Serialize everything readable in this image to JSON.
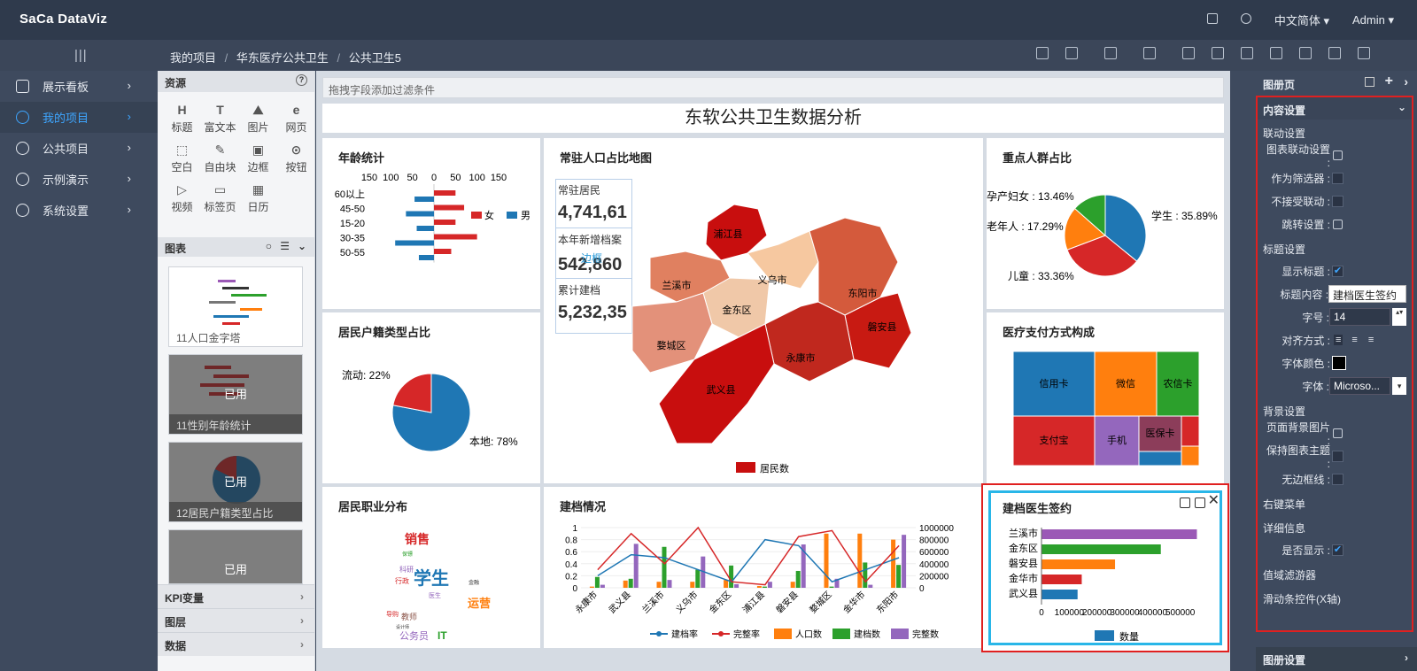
{
  "app": {
    "brand": "SaCa DataViz",
    "language": "中文简体",
    "user": "Admin"
  },
  "breadcrumb": [
    "我的项目",
    "华东医疗公共卫生",
    "公共卫生5"
  ],
  "sidebar": [
    {
      "label": "展示看板",
      "icon": "monitor-icon"
    },
    {
      "label": "我的项目",
      "icon": "user-icon",
      "active": true
    },
    {
      "label": "公共项目",
      "icon": "refresh-icon"
    },
    {
      "label": "示例演示",
      "icon": "play-icon"
    },
    {
      "label": "系统设置",
      "icon": "gear-icon"
    }
  ],
  "resources": {
    "title": "资源",
    "items": [
      "标题",
      "富文本",
      "图片",
      "网页",
      "空白",
      "自由块",
      "边框",
      "按钮",
      "视频",
      "标签页",
      "日历"
    ],
    "charts_title": "图表",
    "thumbs": [
      {
        "caption": "11人口金字塔",
        "used": false
      },
      {
        "caption": "11性别年龄统计",
        "used": true
      },
      {
        "caption": "12居民户籍类型占比",
        "used": true
      },
      {
        "caption": "",
        "used": true
      }
    ],
    "used_label": "已用",
    "sections": [
      "KPI变量",
      "图层",
      "数据"
    ]
  },
  "canvas": {
    "filter_hint": "拖拽字段添加过滤条件",
    "dashboard_title": "东软公共卫生数据分析"
  },
  "panels": {
    "age": {
      "title": "年龄统计",
      "categories": [
        "60以上",
        "45-50",
        "15-20",
        "30-35",
        "50-55"
      ],
      "legend_female": "女",
      "legend_male": "男",
      "ticks": [
        "150",
        "100",
        "50",
        "0",
        "50",
        "100",
        "150"
      ]
    },
    "map": {
      "title": "常驻人口占比地图",
      "kpis": [
        {
          "label": "常驻居民",
          "value": "4,741,61"
        },
        {
          "label": "本年新增档案",
          "value": "542,860"
        },
        {
          "label": "累计建档",
          "value": "5,232,35"
        }
      ],
      "border_label": "边框",
      "regions": [
        "浦江县",
        "兰溪市",
        "义乌市",
        "东阳市",
        "金东区",
        "婺城区",
        "磐安县",
        "永康市",
        "武义县"
      ],
      "legend": "居民数"
    },
    "key_pop": {
      "title": "重点人群占比",
      "slices": [
        {
          "label": "学生 : 35.89%",
          "value": 35.89,
          "color": "#1f77b4"
        },
        {
          "label": "儿童 : 33.36%",
          "value": 33.36,
          "color": "#d62728"
        },
        {
          "label": "老年人 : 17.29%",
          "value": 17.29,
          "color": "#ff7f0e"
        },
        {
          "label": "孕产妇女 : 13.46%",
          "value": 13.46,
          "color": "#2ca02c"
        }
      ]
    },
    "household": {
      "title": "居民户籍类型占比",
      "slices": [
        {
          "label": "本地: 78%",
          "value": 78,
          "color": "#1f77b4"
        },
        {
          "label": "流动: 22%",
          "value": 22,
          "color": "#d62728"
        }
      ]
    },
    "payment": {
      "title": "医疗支付方式构成",
      "tiles": [
        "信用卡",
        "微信",
        "农信卡",
        "支付宝",
        "手机",
        "医保卡"
      ]
    },
    "occupation": {
      "title": "居民职业分布",
      "words": [
        "销售",
        "保镖",
        "科研",
        "学生",
        "行政",
        "金融",
        "医生",
        "运营",
        "导购",
        "教师",
        "设计师",
        "公务员",
        "IT"
      ]
    },
    "archive": {
      "title": "建档情况",
      "categories": [
        "永康市",
        "武义县",
        "兰溪市",
        "义乌市",
        "金东区",
        "浦江县",
        "磐安县",
        "婺城区",
        "金华市",
        "东阳市"
      ],
      "yleft": [
        "1",
        "0.8",
        "0.6",
        "0.4",
        "0.2",
        "0"
      ],
      "yright": [
        "1000000",
        "800000",
        "600000",
        "400000",
        "200000",
        "0"
      ],
      "legend": [
        "建档率",
        "完整率",
        "人口数",
        "建档数",
        "完整数"
      ]
    },
    "signing": {
      "title": "建档医生签约",
      "legend": "数量",
      "xticks": [
        "0",
        "100000",
        "200000",
        "300000",
        "400000",
        "500000"
      ]
    }
  },
  "chart_data": [
    {
      "type": "bar",
      "title": "年龄统计",
      "categories": [
        "60以上",
        "45-50",
        "15-20",
        "30-35",
        "50-55"
      ],
      "series": [
        {
          "name": "女",
          "values": [
            50,
            70,
            50,
            100,
            40
          ]
        },
        {
          "name": "男",
          "values": [
            45,
            65,
            40,
            90,
            35
          ]
        }
      ],
      "xlim": [
        -150,
        150
      ]
    },
    {
      "type": "pie",
      "title": "重点人群占比",
      "categories": [
        "学生",
        "儿童",
        "老年人",
        "孕产妇女"
      ],
      "values": [
        35.89,
        33.36,
        17.29,
        13.46
      ]
    },
    {
      "type": "pie",
      "title": "居民户籍类型占比",
      "categories": [
        "本地",
        "流动"
      ],
      "values": [
        78,
        22
      ]
    },
    {
      "type": "bar",
      "title": "建档医生签约",
      "categories": [
        "兰溪市",
        "金东区",
        "磐安县",
        "金华市",
        "武义县"
      ],
      "values": [
        560000,
        430000,
        265000,
        145000,
        130000
      ],
      "xlim": [
        0,
        600000
      ],
      "legend": "数量"
    },
    {
      "type": "line",
      "title": "建档情况",
      "categories": [
        "永康市",
        "武义县",
        "兰溪市",
        "义乌市",
        "金东区",
        "浦江县",
        "磐安县",
        "婺城区",
        "金华市",
        "东阳市"
      ],
      "series": [
        {
          "name": "建档率",
          "values": [
            0.2,
            0.55,
            0.5,
            0.3,
            0.1,
            0.8,
            0.7,
            0.1,
            0.3,
            0.5
          ]
        },
        {
          "name": "完整率",
          "values": [
            0.3,
            0.9,
            0.4,
            1.0,
            0.1,
            0.05,
            0.85,
            0.95,
            0.1,
            0.7
          ]
        },
        {
          "name": "人口数",
          "values": [
            20000,
            120000,
            100000,
            100000,
            130000,
            30000,
            100000,
            900000,
            900000,
            800000
          ]
        },
        {
          "name": "建档数",
          "values": [
            180000,
            150000,
            680000,
            300000,
            370000,
            20000,
            280000,
            20000,
            420000,
            380000
          ]
        },
        {
          "name": "完整数",
          "values": [
            50000,
            730000,
            130000,
            520000,
            60000,
            100000,
            720000,
            150000,
            50000,
            880000
          ]
        }
      ],
      "ylim": [
        0,
        1
      ],
      "y2lim": [
        0,
        1000000
      ]
    }
  ],
  "rightpanel": {
    "header": "图册页",
    "content_settings": "内容设置",
    "link_group": "联动设置",
    "link_rows": [
      "图表联动设置 :",
      "作为筛选器 :",
      "不接受联动 :",
      "跳转设置 :"
    ],
    "title_group": "标题设置",
    "show_title": "显示标题 :",
    "title_content_label": "标题内容 :",
    "title_content_value": "建档医生签约",
    "font_size_label": "字号 :",
    "font_size_value": "14",
    "align_label": "对齐方式 :",
    "font_color_label": "字体颜色 :",
    "font_label": "字体 :",
    "font_value": "Microso...",
    "bg_group": "背景设置",
    "bg_rows": [
      "页面背景图片 :",
      "保持图表主题 :",
      "无边框线 :"
    ],
    "context_menu": "右键菜单",
    "detail_group": "详细信息",
    "show_detail": "是否显示 :",
    "value_filter": "值域滤游器",
    "slider_x": "滑动条控件(X轴)",
    "footer": "图册设置"
  }
}
